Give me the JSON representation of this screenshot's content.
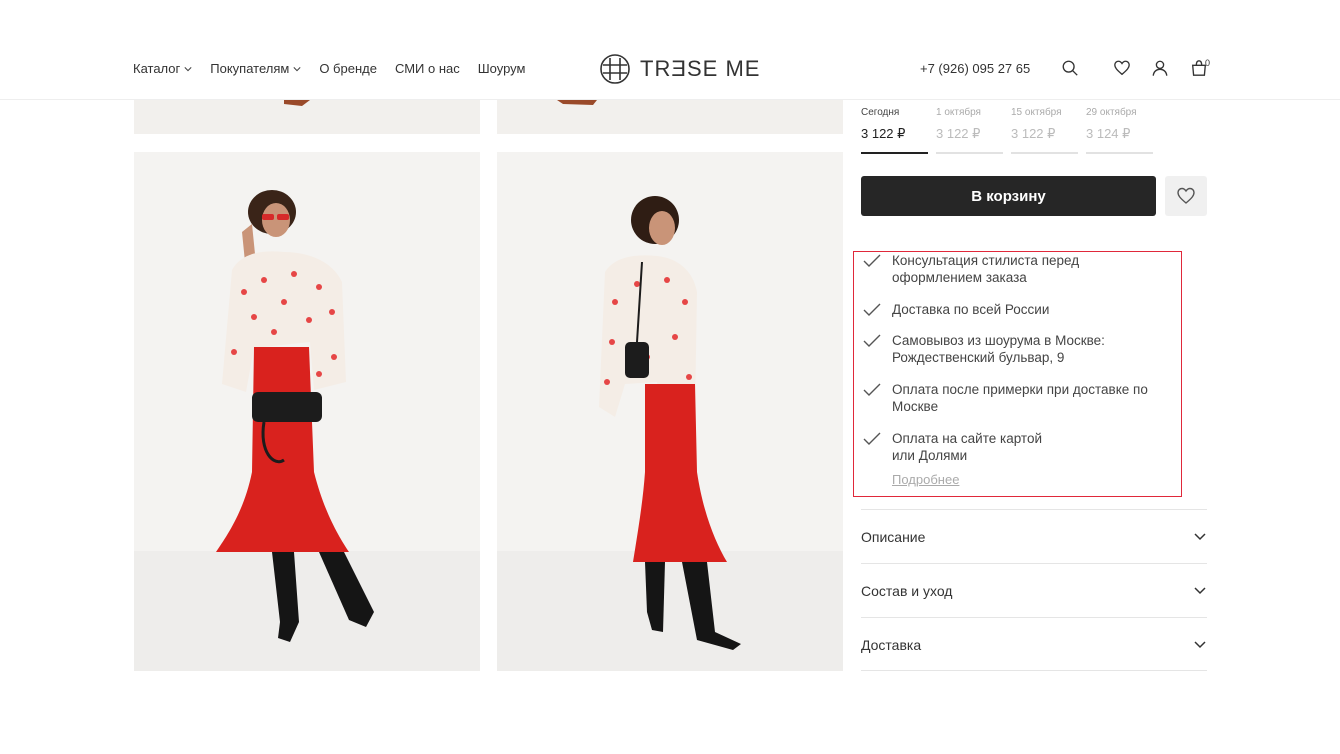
{
  "header": {
    "nav": [
      {
        "label": "Каталог",
        "dropdown": true
      },
      {
        "label": "Покупателям",
        "dropdown": true
      },
      {
        "label": "О бренде",
        "dropdown": false
      },
      {
        "label": "СМИ о нас",
        "dropdown": false
      },
      {
        "label": "Шоурум",
        "dropdown": false
      }
    ],
    "logo_text": "TRƎSE ME",
    "phone": "+7 (926) 095 27 65",
    "cart_count": "0",
    "icons": [
      "search-icon",
      "heart-icon",
      "user-icon",
      "bag-icon"
    ]
  },
  "price_tabs": [
    {
      "date": "Сегодня",
      "price": "3 122 ₽",
      "active": true
    },
    {
      "date": "1 октября",
      "price": "3 122 ₽",
      "active": false
    },
    {
      "date": "15 октября",
      "price": "3 122 ₽",
      "active": false
    },
    {
      "date": "29 октября",
      "price": "3 124 ₽",
      "active": false
    }
  ],
  "cart_button": "В корзину",
  "features": [
    "Консультация стилиста перед оформлением заказа",
    "Доставка по всей России",
    "Самовывоз из шоурума в Москве: Рождественский бульвар, 9",
    "Оплата после примерки при доставке по Москве",
    "Оплата на сайте картой или Долями"
  ],
  "more_link": "Подробнее",
  "accordion": [
    "Описание",
    "Состав и уход",
    "Доставка"
  ],
  "colors": {
    "accent_red": "#e0283a",
    "button_dark": "#262626",
    "skirt_red": "#d9221e"
  }
}
